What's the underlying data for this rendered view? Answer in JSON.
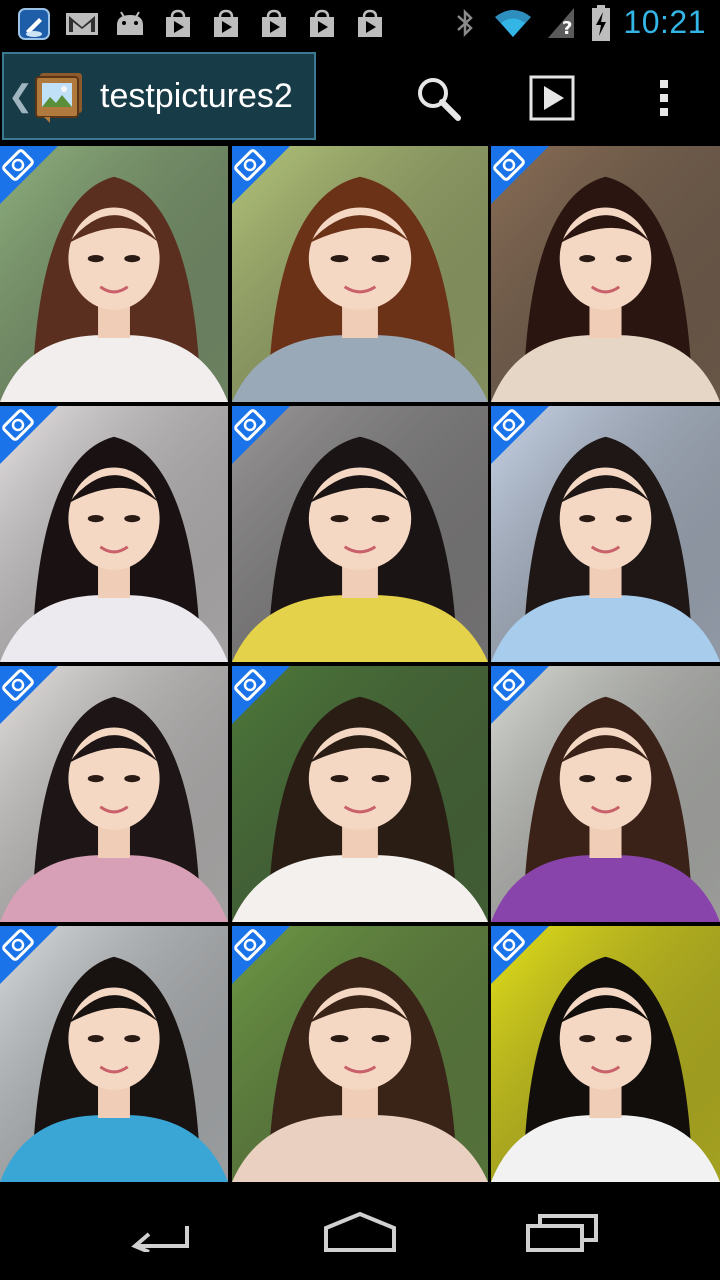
{
  "status_bar": {
    "time": "10:21",
    "left_icons": [
      "app-launcher-icon",
      "gmail-icon",
      "android-debug-icon",
      "play-store-download-icon",
      "play-store-download-icon",
      "play-store-download-icon",
      "play-store-download-icon",
      "play-store-download-icon"
    ],
    "right_icons": [
      "bluetooth-icon",
      "wifi-icon",
      "signal-no-sim-icon",
      "battery-charging-icon"
    ],
    "accent_color": "#33b5e5"
  },
  "action_bar": {
    "album_title": "testpictures2",
    "actions": [
      "search-icon",
      "slideshow-play-icon",
      "overflow-menu-icon"
    ],
    "highlight_color": "#183b48"
  },
  "grid": {
    "columns": 3,
    "rows": 4,
    "photos": [
      {
        "badge": "camera-icon",
        "bg": "#8fb27e",
        "hair": "#5a2f1f",
        "shirt": "#f2eeee"
      },
      {
        "badge": "camera-icon",
        "bg": "#b5c77a",
        "hair": "#6b3218",
        "shirt": "#9aa9b8"
      },
      {
        "badge": "camera-icon",
        "bg": "#8a6e56",
        "hair": "#2a1510",
        "shirt": "#e6d6c6"
      },
      {
        "badge": "camera-icon",
        "bg": "#e8e4e6",
        "hair": "#1a1212",
        "shirt": "#ece9ef"
      },
      {
        "badge": "camera-icon",
        "bg": "#9a9898",
        "hair": "#1b1414",
        "shirt": "#e3d24a"
      },
      {
        "badge": "camera-icon",
        "bg": "#c9d6ea",
        "hair": "#1e1716",
        "shirt": "#a8cdec"
      },
      {
        "badge": "camera-icon",
        "bg": "#e6e2e2",
        "hair": "#1e1616",
        "shirt": "#d8a0b6"
      },
      {
        "badge": "camera-icon",
        "bg": "#4e7a3a",
        "hair": "#2a1d14",
        "shirt": "#f4f0ee"
      },
      {
        "badge": "camera-icon",
        "bg": "#d9dbd6",
        "hair": "#3a2218",
        "shirt": "#8844aa"
      },
      {
        "badge": "camera-icon",
        "bg": "#d9dde0",
        "hair": "#181210",
        "shirt": "#39a6d6"
      },
      {
        "badge": "camera-icon",
        "bg": "#6e9a44",
        "hair": "#3a2418",
        "shirt": "#e9d0c0"
      },
      {
        "badge": "camera-icon",
        "bg": "#e7e31a",
        "hair": "#120e0c",
        "shirt": "#f2f2f2"
      }
    ],
    "badge_color": "#1a73e8"
  },
  "nav_bar": {
    "buttons": [
      "back-icon",
      "home-icon",
      "recent-apps-icon"
    ]
  }
}
